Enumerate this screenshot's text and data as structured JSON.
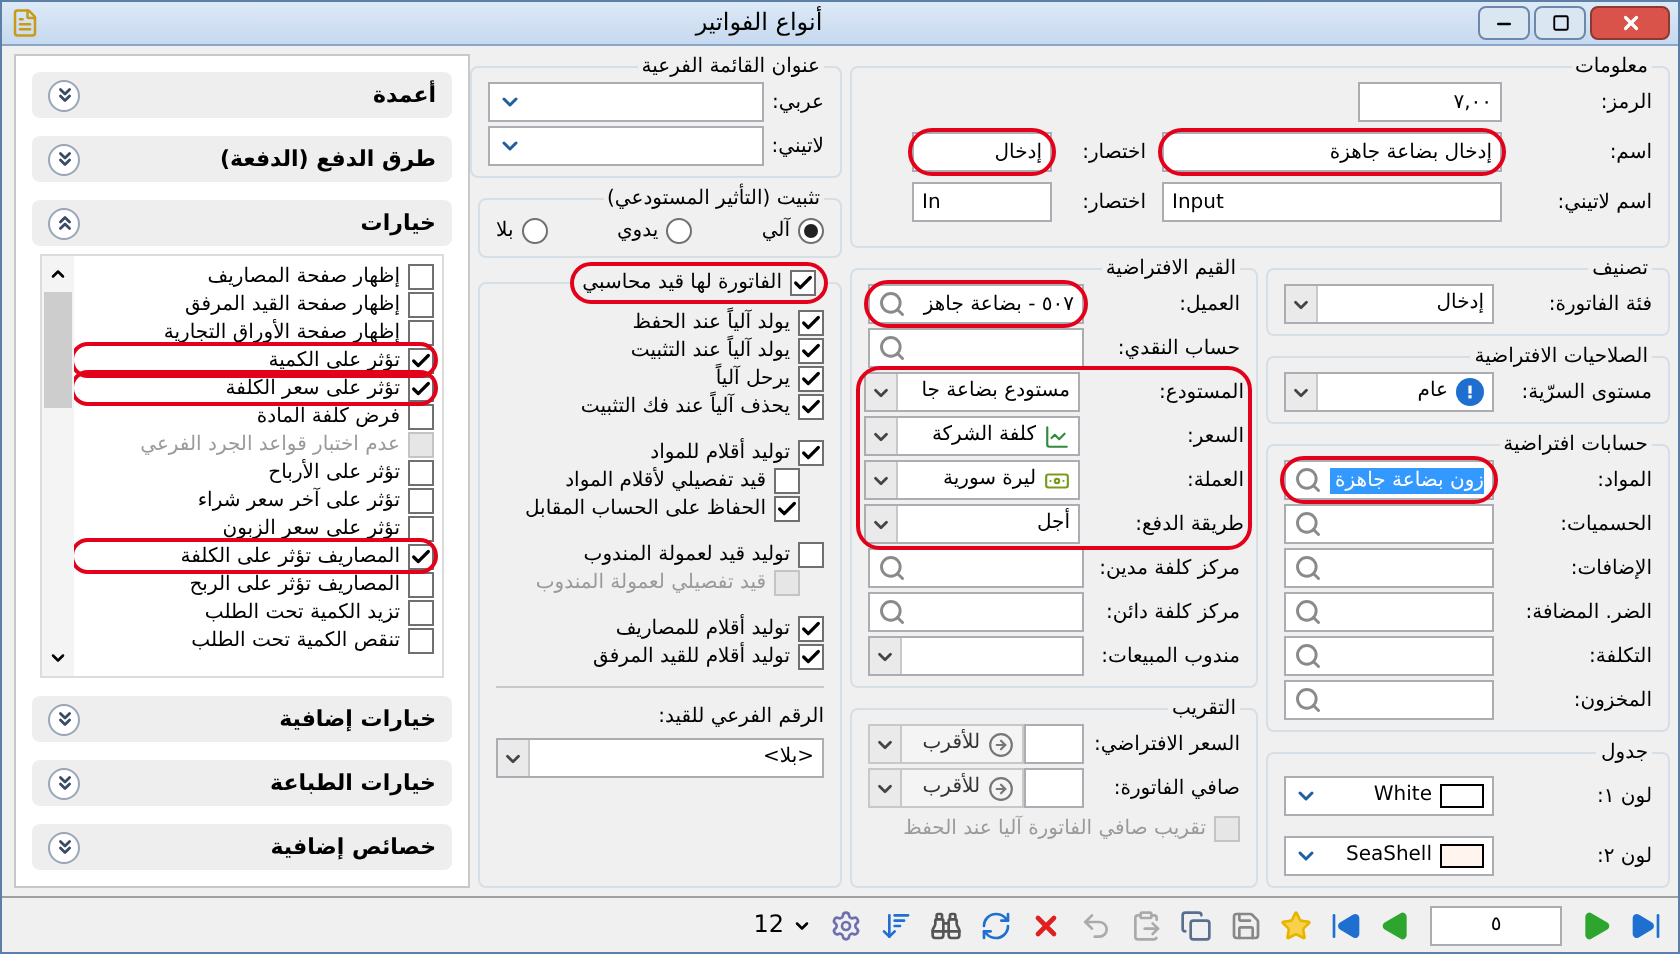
{
  "window": {
    "title": "أنواع الفواتير"
  },
  "info": {
    "title": "معلومات",
    "code": {
      "label": "الرمز:",
      "value": "٧,٠٠"
    },
    "name": {
      "label": "اسم:",
      "value": "إدخال بضاعة جاهزة",
      "highlighted": true
    },
    "short": {
      "label": "اختصار:",
      "value": "إدخال",
      "highlighted": true
    },
    "latin_name": {
      "label": "اسم لاتيني:",
      "value": "Input",
      "highlighted": false
    },
    "latin_short": {
      "label": "اختصار:",
      "value": "In",
      "highlighted": false
    }
  },
  "classification": {
    "title": "تصنيف",
    "label": "فئة الفاتورة:",
    "value": "إدخال"
  },
  "permissions": {
    "title": "الصلاحيات الافتراضية",
    "label": "مستوى السرّية:",
    "value": "عام"
  },
  "default_accounts": {
    "title": "حسابات افتراضية",
    "fields": [
      {
        "label": "المواد:",
        "value": "زون بضاعة جاهزة",
        "text_selected": true,
        "highlighted": true
      },
      {
        "label": "الحسميات:",
        "highlighted": false
      },
      {
        "label": "الإضافات:",
        "highlighted": false
      },
      {
        "label": "الضر. المضافة:",
        "highlighted": false
      },
      {
        "label": "التكلفة:",
        "highlighted": false
      },
      {
        "label": "المخزون:",
        "highlighted": false
      }
    ]
  },
  "grid": {
    "title": "جدول",
    "colors": [
      {
        "label": "لون ١:",
        "value": "White",
        "color": "#ffffff"
      },
      {
        "label": "لون ٢:",
        "value": "SeaShell",
        "color": "#fff5ee"
      }
    ]
  },
  "defaults": {
    "title": "القيم الافتراضية",
    "rows": [
      {
        "kind": "lookup",
        "label": "العميل:",
        "value": "٥٠٧ - بضاعة جاهز",
        "highlighted": true
      },
      {
        "kind": "lookup",
        "label": "حساب النقدي:",
        "highlighted": false
      },
      {
        "kind": "group",
        "highlighted": true,
        "children": [
          {
            "kind": "combo",
            "label": "المستودع:",
            "value": "مستودع بضاعة جا"
          },
          {
            "kind": "price",
            "label": "السعر:",
            "value": "كلفة الشركة"
          },
          {
            "kind": "currency",
            "label": "العملة:",
            "value": "ليرة سورية"
          },
          {
            "kind": "combo",
            "label": "طريقة الدفع:",
            "value": "أجل"
          }
        ]
      },
      {
        "kind": "lookup",
        "label": "مركز كلفة مدين:",
        "highlighted": false
      },
      {
        "kind": "lookup",
        "label": "مركز كلفة دائن:",
        "highlighted": false
      },
      {
        "kind": "combo",
        "label": "مندوب المبيعات:"
      }
    ]
  },
  "rounding": {
    "title": "التقريب",
    "rows": [
      {
        "label": "السعر الافتراضي:",
        "mode": "للأقرب",
        "disabled": true
      },
      {
        "label": "صافي الفاتورة:",
        "mode": "للأقرب",
        "disabled": true
      }
    ],
    "auto": {
      "label": "تقريب صافي الفاتورة آليا عند الحفظ",
      "checked": false,
      "disabled": true
    }
  },
  "submenu": {
    "title": "عنوان القائمة الفرعية",
    "fields": [
      {
        "label": "عربي:"
      },
      {
        "label": "لاتيني:"
      }
    ]
  },
  "posting": {
    "title": "تثبيت (التأثير المستودعي)",
    "options": [
      {
        "label": "آلي",
        "selected": true
      },
      {
        "label": "يدوي",
        "selected": false
      },
      {
        "label": "بلا",
        "selected": false
      }
    ]
  },
  "entry": {
    "label": "الفاتورة لها قيد محاسبي",
    "checked": true,
    "highlighted": true,
    "groups": [
      {
        "items": [
          {
            "label": "يولد آلياً عند الحفظ",
            "checked": true,
            "disabled": false
          },
          {
            "label": "يولد آلياً عند التثبيت",
            "checked": true,
            "disabled": false
          },
          {
            "label": "يرحل آلياً",
            "checked": true,
            "disabled": false
          },
          {
            "label": "يحذف آلياً عند فك التثبيت",
            "checked": true,
            "disabled": false
          }
        ]
      },
      {
        "items": [
          {
            "label": "توليد أقلام للمواد",
            "checked": true,
            "disabled": false,
            "children": [
              {
                "label": "قيد تفصيلي لأقلام المواد",
                "checked": false,
                "disabled": false
              },
              {
                "label": "الحفاظ على الحساب المقابل",
                "checked": true,
                "disabled": false
              }
            ]
          }
        ]
      },
      {
        "items": [
          {
            "label": "توليد قيد لعمولة المندوب",
            "checked": false,
            "disabled": false,
            "children": [
              {
                "label": "قيد تفصيلي لعمولة المندوب",
                "checked": false,
                "disabled": true
              }
            ]
          }
        ]
      },
      {
        "items": [
          {
            "label": "توليد أقلام للمصاريف",
            "checked": true,
            "disabled": false
          },
          {
            "label": "توليد أقلام للقيد المرفق",
            "checked": true,
            "disabled": false
          }
        ]
      }
    ],
    "sub_number": {
      "label": "الرقم الفرعي للقيد:",
      "value": "<بلا>"
    }
  },
  "side_panel": {
    "sections": [
      {
        "title": "أعمدة",
        "expanded": false
      },
      {
        "title": "طرق الدفع (الدفعة)",
        "expanded": false
      },
      {
        "title": "خيارات",
        "expanded": true,
        "options": [
          {
            "label": "إظهار صفحة المصاريف",
            "checked": false,
            "disabled": false,
            "highlighted": false
          },
          {
            "label": "إظهار صفحة القيد المرفق",
            "checked": false,
            "disabled": false,
            "highlighted": false
          },
          {
            "label": "إظهار صفحة الأوراق التجارية",
            "checked": false,
            "disabled": false,
            "highlighted": false
          },
          {
            "label": "تؤثر على الكمية",
            "checked": true,
            "disabled": false,
            "highlighted": true
          },
          {
            "label": "تؤثر على سعر الكلفة",
            "checked": true,
            "disabled": false,
            "highlighted": true
          },
          {
            "label": "فرض كلفة المادة",
            "checked": false,
            "disabled": false,
            "highlighted": false
          },
          {
            "label": "عدم اختبار قواعد الجرد الفرعي",
            "checked": false,
            "disabled": true,
            "highlighted": false
          },
          {
            "label": "تؤثر على الأرباح",
            "checked": false,
            "disabled": false,
            "highlighted": false
          },
          {
            "label": "تؤثر على آخر سعر شراء",
            "checked": false,
            "disabled": false,
            "highlighted": false
          },
          {
            "label": "تؤثر على سعر الزبون",
            "checked": false,
            "disabled": false,
            "highlighted": false
          },
          {
            "label": "المصاريف تؤثر على الكلفة",
            "checked": true,
            "disabled": false,
            "highlighted": true
          },
          {
            "label": "المصاريف تؤثر على الربح",
            "checked": false,
            "disabled": false,
            "highlighted": false
          },
          {
            "label": "تزيد الكمية تحت الطلب",
            "checked": false,
            "disabled": false,
            "highlighted": false
          },
          {
            "label": "تنقص الكمية تحت الطلب",
            "checked": false,
            "disabled": false,
            "highlighted": false
          }
        ]
      },
      {
        "title": "خيارات إضافية",
        "expanded": false
      },
      {
        "title": "خيارات الطباعة",
        "expanded": false
      },
      {
        "title": "خصائص إضافية",
        "expanded": false
      }
    ]
  },
  "toolbar": {
    "page_size": "12",
    "record": "٥"
  }
}
